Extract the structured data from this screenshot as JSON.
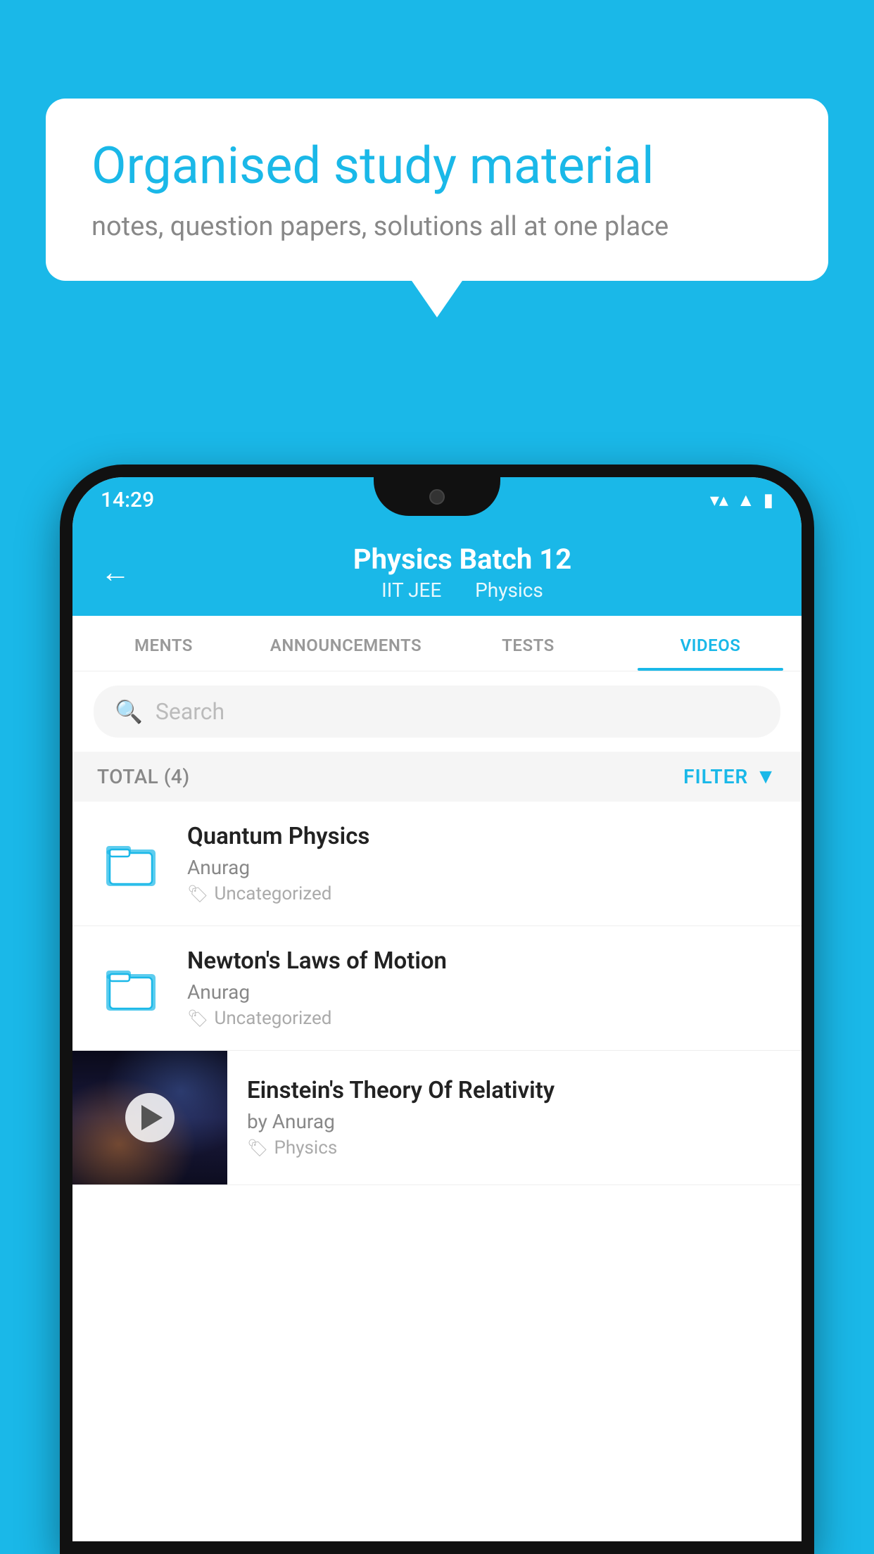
{
  "background_color": "#1ab8e8",
  "speech_bubble": {
    "heading": "Organised study material",
    "subtext": "notes, question papers, solutions all at one place"
  },
  "phone": {
    "status_bar": {
      "time": "14:29",
      "wifi_icon": "wifi",
      "signal_icon": "signal",
      "battery_icon": "battery"
    },
    "app_header": {
      "back_label": "←",
      "title": "Physics Batch 12",
      "subtitle_part1": "IIT JEE",
      "subtitle_part2": "Physics"
    },
    "tabs": [
      {
        "label": "MENTS",
        "active": false
      },
      {
        "label": "ANNOUNCEMENTS",
        "active": false
      },
      {
        "label": "TESTS",
        "active": false
      },
      {
        "label": "VIDEOS",
        "active": true
      }
    ],
    "search": {
      "placeholder": "Search"
    },
    "filter_bar": {
      "total_label": "TOTAL (4)",
      "filter_label": "FILTER"
    },
    "videos": [
      {
        "title": "Quantum Physics",
        "author": "Anurag",
        "tag": "Uncategorized",
        "type": "folder"
      },
      {
        "title": "Newton's Laws of Motion",
        "author": "Anurag",
        "tag": "Uncategorized",
        "type": "folder"
      },
      {
        "title": "Einstein's Theory Of Relativity",
        "author": "by Anurag",
        "tag": "Physics",
        "type": "video"
      }
    ]
  }
}
